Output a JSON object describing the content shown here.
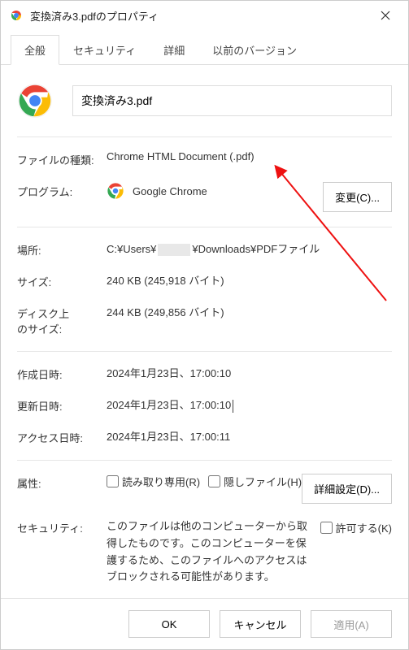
{
  "titlebar": {
    "title": "変換済み3.pdfのプロパティ"
  },
  "tabs": {
    "general": "全般",
    "security": "セキュリティ",
    "details": "詳細",
    "previous": "以前のバージョン"
  },
  "file": {
    "name_value": "変換済み3.pdf"
  },
  "labels": {
    "filetype": "ファイルの種類:",
    "program": "プログラム:",
    "location": "場所:",
    "size": "サイズ:",
    "disksize_l1": "ディスク上",
    "disksize_l2": "のサイズ:",
    "created": "作成日時:",
    "modified": "更新日時:",
    "accessed": "アクセス日時:",
    "attributes": "属性:",
    "security_label": "セキュリティ:"
  },
  "values": {
    "filetype": "Chrome HTML Document (.pdf)",
    "program": "Google Chrome",
    "location_prefix": "C:¥Users¥",
    "location_suffix": "¥Downloads¥PDFファイル",
    "size": "240 KB (245,918 バイト)",
    "disksize": "244 KB (249,856 バイト)",
    "created": "2024年1月23日、17:00:10",
    "modified": "2024年1月23日、17:00:10",
    "accessed": "2024年1月23日、17:00:11",
    "security_text": "このファイルは他のコンピューターから取得したものです。このコンピューターを保護するため、このファイルへのアクセスはブロックされる可能性があります。"
  },
  "buttons": {
    "change": "変更(C)...",
    "advanced": "詳細設定(D)...",
    "ok": "OK",
    "cancel": "キャンセル",
    "apply": "適用(A)"
  },
  "checkboxes": {
    "readonly": "読み取り専用(R)",
    "hidden": "隠しファイル(H)",
    "allow": "許可する(K)"
  },
  "icons": {
    "chrome": "chrome-icon",
    "close": "close-icon"
  }
}
